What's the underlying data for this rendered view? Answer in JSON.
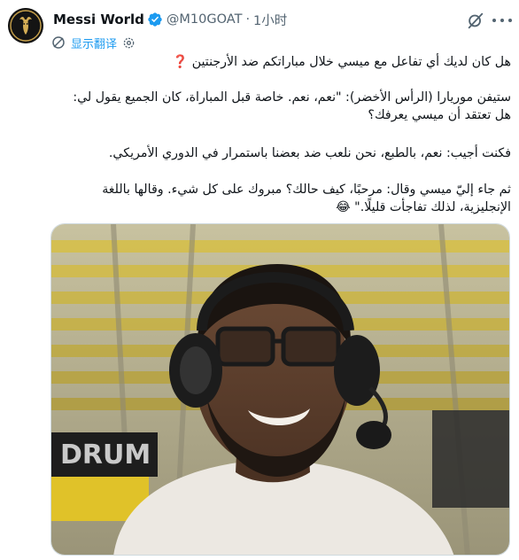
{
  "tweet": {
    "author": {
      "display_name": "Messi World",
      "handle": "@M10GOAT",
      "verified": true,
      "avatar_icon": "goat-logo-avatar"
    },
    "separator": "·",
    "time": "1小时",
    "translate_label": "显示翻译",
    "body": {
      "p1": "هل كان لديك أي تفاعل مع ميسي خلال مباراتكم ضد الأرجنتين",
      "p1_emoji": "❓",
      "p2": "ستيفن موريارا (الرأس الأخضر): \"نعم، نعم. خاصة قبل المباراة، كان الجميع يقول لي: هل تعتقد أن ميسي يعرفك؟",
      "p3": "فكنت أجيب: نعم، بالطبع، نحن نلعب ضد بعضنا باستمرار في الدوري الأمريكي.",
      "p4": "ثم جاء إليّ ميسي وقال: مرحبًا، كيف حالك؟ مبروك على كل شيء. وقالها باللغة الإنجليزية، لذلك تفاجأت قليلًا.\"",
      "p4_emoji": "😂"
    },
    "media": {
      "alt": "",
      "stadium_banner_text": "DRUM"
    },
    "colors": {
      "accent": "#1d9bf0",
      "verified": "#1d9bf0",
      "muted_text": "#536471",
      "stadium_seats": "#e8c630"
    }
  }
}
